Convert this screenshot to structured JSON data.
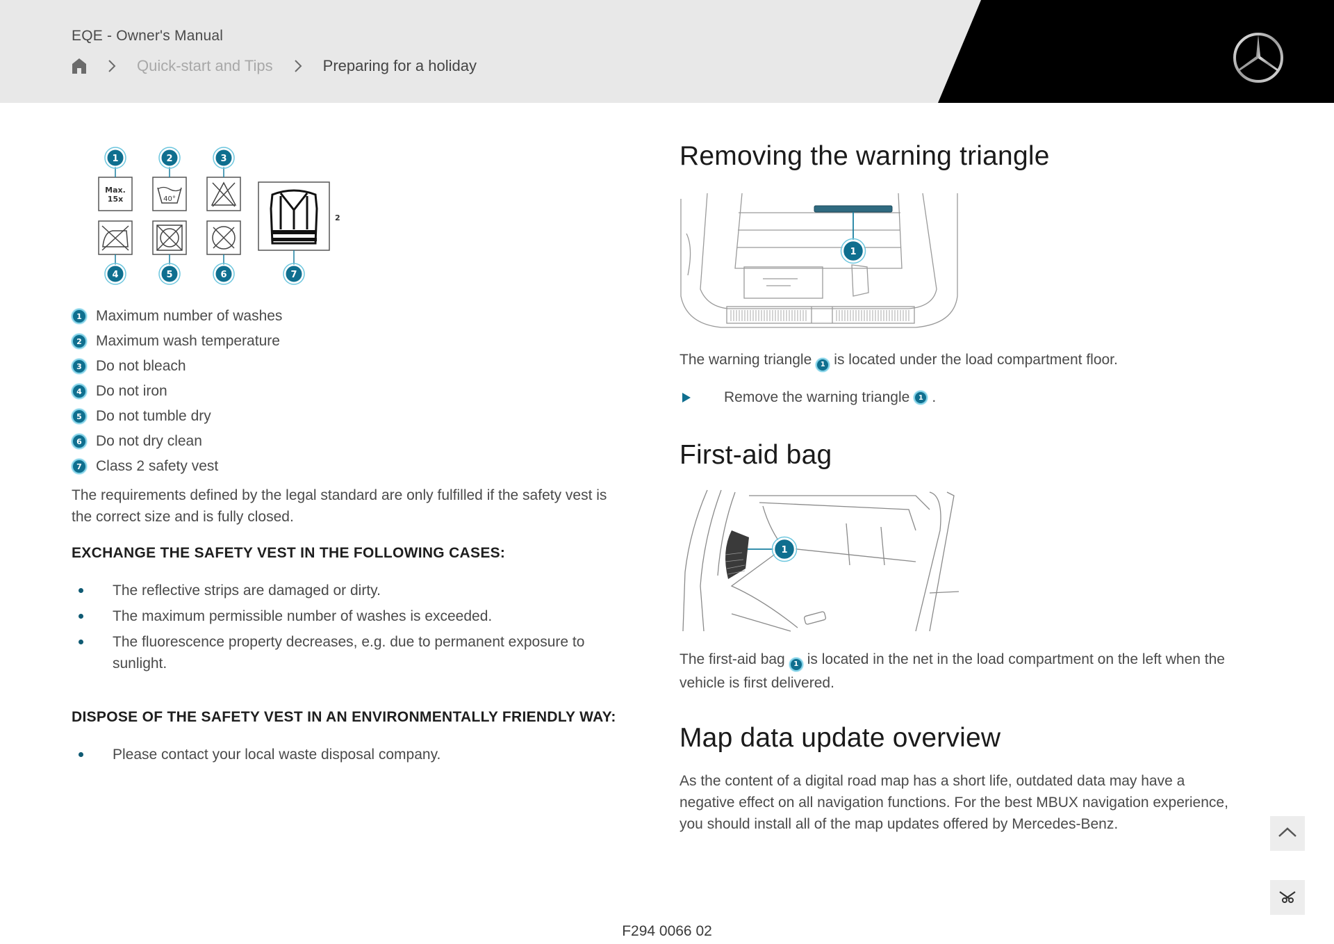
{
  "header": {
    "app_title": "EQE - Owner's Manual",
    "breadcrumb": [
      {
        "label": "Quick-start and Tips",
        "icon": "chevron-right-icon"
      },
      {
        "label": "Preparing for a holiday",
        "icon": "chevron-right-icon"
      }
    ],
    "home_icon": "home-icon",
    "logo": "mercedes-star-logo"
  },
  "colors": {
    "accent": "#0f6f8f",
    "header_bg": "#e8e8e8",
    "header_black": "#000000"
  },
  "safety_vest": {
    "symbols": [
      {
        "number": "1",
        "text": "Max.\n15x"
      },
      {
        "number": "2",
        "text": "40°"
      },
      {
        "number": "3"
      },
      {
        "number": "4"
      },
      {
        "number": "5"
      },
      {
        "number": "6"
      },
      {
        "number": "7",
        "class_label": "2"
      }
    ],
    "legend": [
      {
        "number": "1",
        "label": "Maximum number of washes"
      },
      {
        "number": "2",
        "label": "Maximum wash temperature"
      },
      {
        "number": "3",
        "label": "Do not bleach"
      },
      {
        "number": "4",
        "label": "Do not iron"
      },
      {
        "number": "5",
        "label": "Do not tumble dry"
      },
      {
        "number": "6",
        "label": "Do not dry clean"
      },
      {
        "number": "7",
        "label": "Class 2 safety vest"
      }
    ],
    "requirements": "The requirements defined by the legal standard are only fulfilled if the safety vest is the correct size and is fully closed.",
    "exchange_heading": "EXCHANGE THE SAFETY VEST IN THE FOLLOWING CASES:",
    "exchange_items": [
      "The reflective strips are damaged or dirty.",
      "The maximum permissible number of washes is exceeded.",
      "The fluorescence property decreases, e.g. due to permanent exposure to sunlight."
    ],
    "dispose_heading": "DISPOSE OF THE SAFETY VEST IN AN ENVIRONMENTALLY FRIENDLY WAY:",
    "dispose_items": [
      "Please contact your local waste disposal company."
    ]
  },
  "warning_triangle": {
    "title": "Removing the warning triangle",
    "callout": "1",
    "text_before": "The warning triangle",
    "text_after": "is located under the load compartment floor.",
    "step_before": "Remove the warning triangle",
    "step_after": "."
  },
  "first_aid": {
    "title": "First-aid bag",
    "callout": "1",
    "text_before": "The first-aid bag",
    "text_after": "is located in the net in the load compartment on the left when the vehicle is first delivered."
  },
  "map_update": {
    "title": "Map data update overview",
    "text": "As the content of a digital road map has a short life, outdated data may have a negative effect on all navigation functions. For the best MBUX navigation experience, you should install all of the map updates offered by Mercedes-Benz."
  },
  "controls": {
    "scroll_top_icon": "chevron-up-icon",
    "tool_icon": "scissors-icon"
  },
  "footer": {
    "image_code": "F294 0066 02"
  }
}
